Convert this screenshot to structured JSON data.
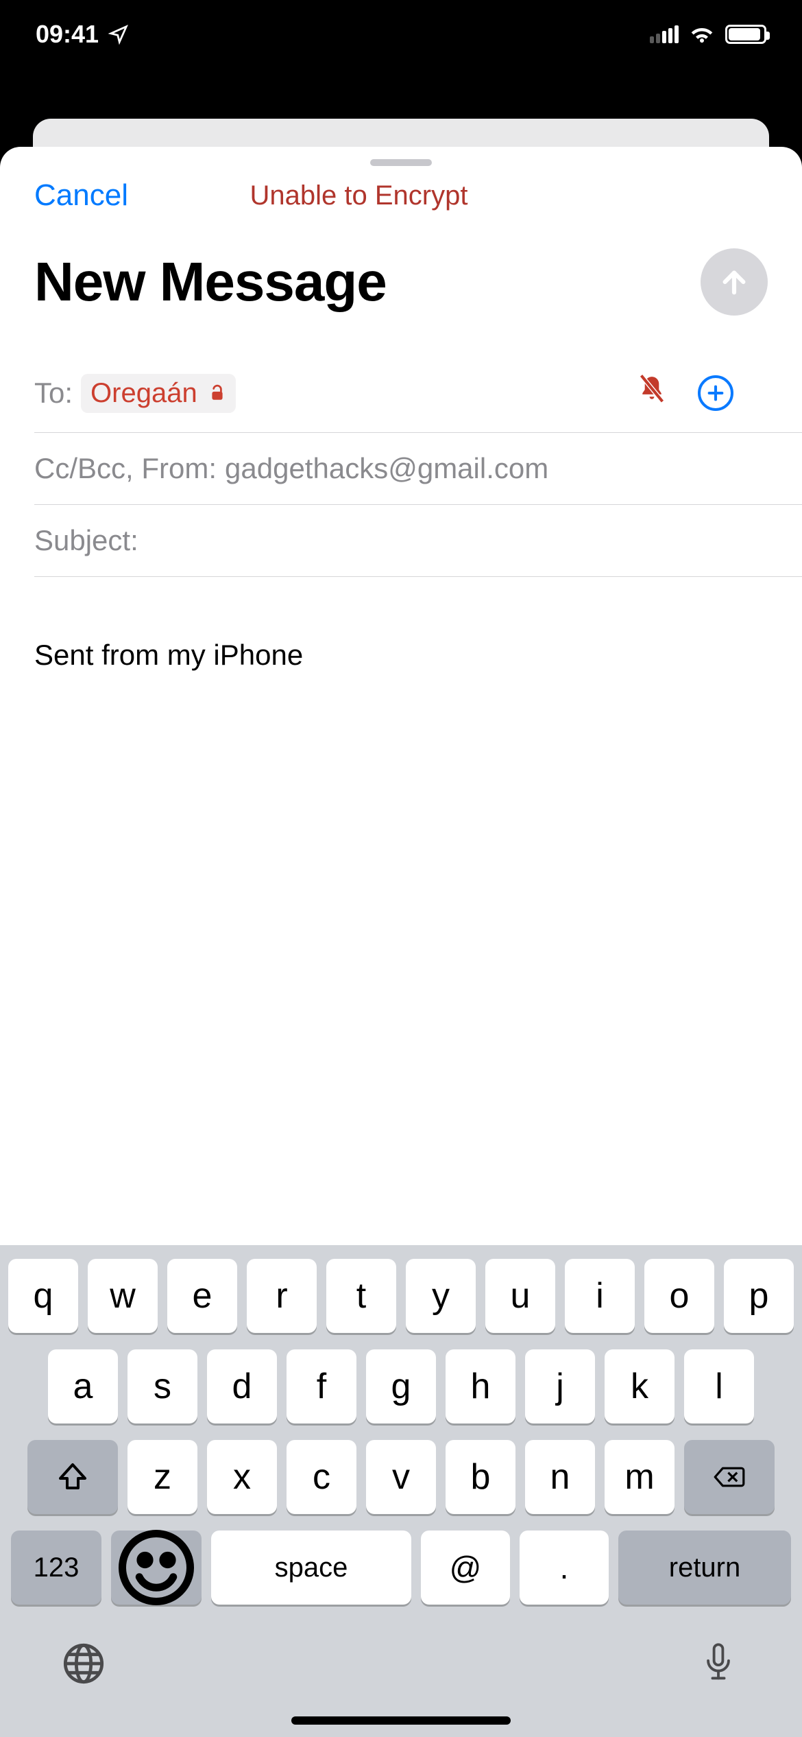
{
  "status": {
    "time": "09:41"
  },
  "header": {
    "cancel": "Cancel",
    "encrypt": "Unable to Encrypt"
  },
  "compose": {
    "title": "New Message",
    "to_label": "To:",
    "recipient": "Oregaán",
    "ccbcc_label": "Cc/Bcc, From:",
    "from_address": "gadgethacks@gmail.com",
    "subject_label": "Subject:",
    "body": "Sent from my iPhone"
  },
  "keyboard": {
    "row1": [
      "q",
      "w",
      "e",
      "r",
      "t",
      "y",
      "u",
      "i",
      "o",
      "p"
    ],
    "row2": [
      "a",
      "s",
      "d",
      "f",
      "g",
      "h",
      "j",
      "k",
      "l"
    ],
    "row3": [
      "z",
      "x",
      "c",
      "v",
      "b",
      "n",
      "m"
    ],
    "k123": "123",
    "space": "space",
    "at": "@",
    "dot": ".",
    "ret": "return"
  }
}
